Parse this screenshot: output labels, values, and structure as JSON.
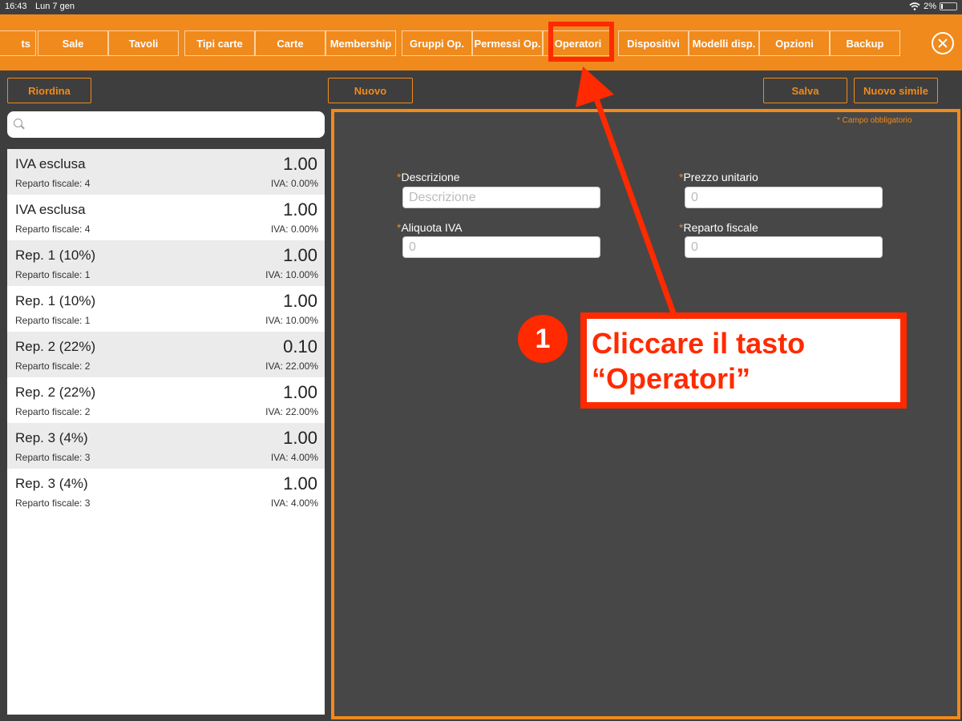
{
  "status_bar": {
    "time": "16:43",
    "date": "Lun 7 gen",
    "battery": "2%"
  },
  "tabs": [
    "ts",
    "Sale",
    "Tavoli",
    "Tipi carte",
    "Carte",
    "Membership",
    "Gruppi Op.",
    "Permessi Op.",
    "Operatori",
    "Dispositivi",
    "Modelli disp.",
    "Opzioni",
    "Backup"
  ],
  "toolbar": {
    "reorder": "Riordina",
    "new": "Nuovo",
    "save": "Salva",
    "new_similar": "Nuovo simile"
  },
  "list": [
    {
      "title": "IVA esclusa",
      "price": "1.00",
      "department": "Reparto fiscale: 4",
      "vat": "IVA: 0.00%"
    },
    {
      "title": "IVA esclusa",
      "price": "1.00",
      "department": "Reparto fiscale: 4",
      "vat": "IVA: 0.00%"
    },
    {
      "title": "Rep. 1 (10%)",
      "price": "1.00",
      "department": "Reparto fiscale: 1",
      "vat": "IVA: 10.00%"
    },
    {
      "title": "Rep. 1 (10%)",
      "price": "1.00",
      "department": "Reparto fiscale: 1",
      "vat": "IVA: 10.00%"
    },
    {
      "title": "Rep. 2 (22%)",
      "price": "0.10",
      "department": "Reparto fiscale: 2",
      "vat": "IVA: 22.00%"
    },
    {
      "title": "Rep. 2 (22%)",
      "price": "1.00",
      "department": "Reparto fiscale: 2",
      "vat": "IVA: 22.00%"
    },
    {
      "title": "Rep. 3 (4%)",
      "price": "1.00",
      "department": "Reparto fiscale: 3",
      "vat": "IVA: 4.00%"
    },
    {
      "title": "Rep. 3 (4%)",
      "price": "1.00",
      "department": "Reparto fiscale: 3",
      "vat": "IVA: 4.00%"
    }
  ],
  "form": {
    "mandatory_note": "* Campo obbligatorio",
    "asterisk": "*",
    "description": {
      "label": "Descrizione",
      "placeholder": "Descrizione"
    },
    "unit_price": {
      "label": "Prezzo unitario",
      "placeholder": "0"
    },
    "vat_rate": {
      "label": "Aliquota IVA",
      "placeholder": "0"
    },
    "fiscal_department": {
      "label": "Reparto fiscale",
      "placeholder": "0"
    }
  },
  "annotation": {
    "step": "1",
    "line1": "Cliccare il tasto",
    "line2": "“Operatori”"
  },
  "colors": {
    "accent": "#f08a1c",
    "background": "#3e3e3e",
    "annotation": "#ff2a00"
  }
}
